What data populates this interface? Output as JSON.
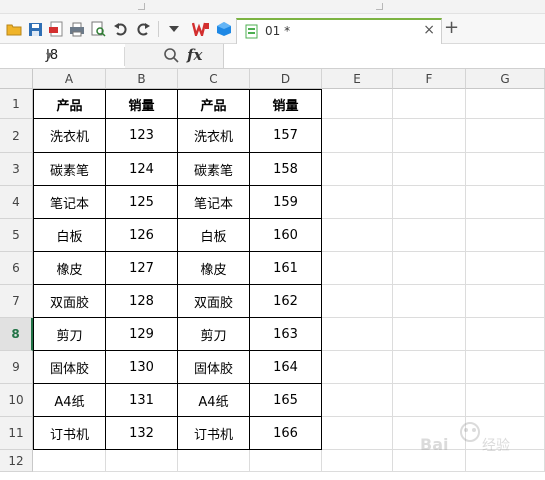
{
  "toolbar": {
    "tab_label": "01 *",
    "tab_close": "×",
    "new_tab": "+"
  },
  "formula_bar": {
    "cell_ref": "J8",
    "fx": "fx",
    "formula": ""
  },
  "sheet": {
    "columns": [
      "A",
      "B",
      "C",
      "D",
      "E",
      "F",
      "G"
    ],
    "rows": [
      "1",
      "2",
      "3",
      "4",
      "5",
      "6",
      "7",
      "8",
      "9",
      "10",
      "11",
      "12"
    ],
    "active_row": "8",
    "headers": [
      "产品",
      "销量",
      "产品",
      "销量"
    ],
    "data": [
      [
        "洗衣机",
        "123",
        "洗衣机",
        "157"
      ],
      [
        "碳素笔",
        "124",
        "碳素笔",
        "158"
      ],
      [
        "笔记本",
        "125",
        "笔记本",
        "159"
      ],
      [
        "白板",
        "126",
        "白板",
        "160"
      ],
      [
        "橡皮",
        "127",
        "橡皮",
        "161"
      ],
      [
        "双面胶",
        "128",
        "双面胶",
        "162"
      ],
      [
        "剪刀",
        "129",
        "剪刀",
        "163"
      ],
      [
        "固体胶",
        "130",
        "固体胶",
        "164"
      ],
      [
        "A4纸",
        "131",
        "A4纸",
        "165"
      ],
      [
        "订书机",
        "132",
        "订书机",
        "166"
      ]
    ]
  },
  "colors": {
    "accent": "#7cb342",
    "active_row_text": "#217346",
    "wps_red": "#d32f2f"
  }
}
